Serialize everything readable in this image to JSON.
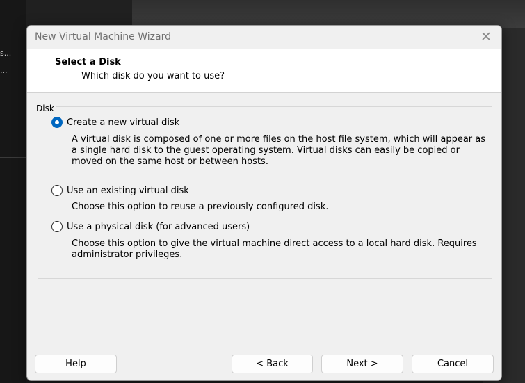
{
  "background": {
    "truncated_labels": [
      "s...",
      "..."
    ]
  },
  "dialog": {
    "title": "New Virtual Machine Wizard",
    "close_glyph": "✕",
    "header": {
      "title": "Select a Disk",
      "subtitle": "Which disk do you want to use?"
    },
    "group_label": "Disk",
    "options": [
      {
        "label": "Create a new virtual disk",
        "selected": true,
        "description": "A virtual disk is composed of one or more files on the host file system, which will appear as a single hard disk to the guest operating system. Virtual disks can easily be copied or moved on the same host or between hosts."
      },
      {
        "label": "Use an existing virtual disk",
        "selected": false,
        "description": "Choose this option to reuse a previously configured disk."
      },
      {
        "label": "Use a physical disk (for advanced users)",
        "selected": false,
        "description": "Choose this option to give the virtual machine direct access to a local hard disk. Requires administrator privileges."
      }
    ],
    "buttons": {
      "help": "Help",
      "back": "< Back",
      "next": "Next >",
      "cancel": "Cancel"
    }
  },
  "colors": {
    "accent": "#0067c0",
    "dialog_bg": "#f0f0f0",
    "header_bg": "#ffffff"
  }
}
